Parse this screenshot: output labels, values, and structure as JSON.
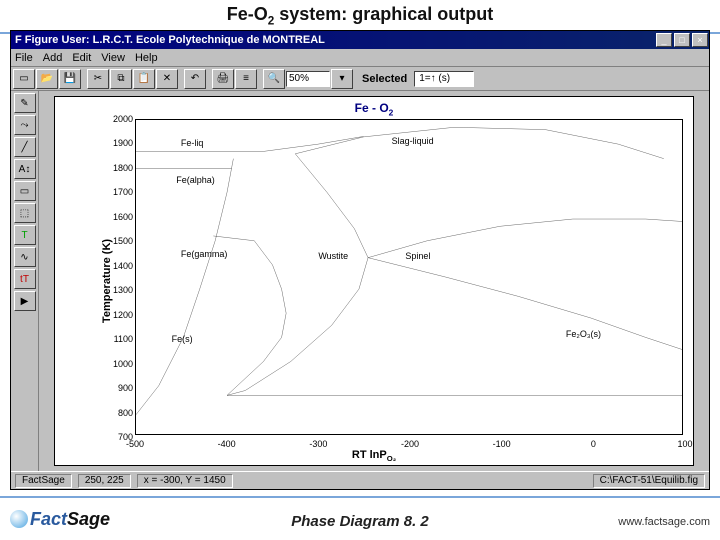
{
  "slide": {
    "title_prefix": "Fe-O",
    "title_sub": "2",
    "title_suffix": " system: graphical output",
    "footer_center": "Phase Diagram  8. 2",
    "footer_url": "www.factsage.com",
    "logo_left": "Fact",
    "logo_right": "Sage"
  },
  "window": {
    "title": "F Figure    User: L.R.C.T.   Ecole Polytechnique de MONTREAL",
    "min_label": "_",
    "max_label": "□",
    "close_label": "×"
  },
  "menus": [
    "File",
    "Add",
    "Edit",
    "View",
    "Help"
  ],
  "toolbar_zoom": "50%",
  "toolbar_selected_label": "Selected",
  "toolbar_selected_value": "1=↑ (s)",
  "status": {
    "app": "FactSage",
    "xy": "250, 225",
    "coords": "x = -300, Y = 1450",
    "path": "C:\\FACT-51\\Equilib.fig"
  },
  "chart_data": {
    "type": "phase-diagram",
    "title_prefix": "Fe - O",
    "title_sub": "2",
    "xlabel_prefix": "RT lnP",
    "xlabel_sub": "O₂",
    "ylabel": "Temperature (K)",
    "xlim": [
      -500,
      100
    ],
    "ylim": [
      700,
      2000
    ],
    "xticks": [
      -500,
      -400,
      -300,
      -200,
      -100,
      0,
      100
    ],
    "yticks": [
      700,
      800,
      900,
      1000,
      1100,
      1200,
      1300,
      1400,
      1500,
      1600,
      1700,
      1800,
      1900,
      2000
    ],
    "phase_labels": [
      {
        "text": "Fe-liq",
        "x": -450,
        "y": 1900
      },
      {
        "text": "Fe(alpha)",
        "x": -455,
        "y": 1750
      },
      {
        "text": "Fe(gamma)",
        "x": -450,
        "y": 1450
      },
      {
        "text": "Fe(s)",
        "x": -460,
        "y": 1100
      },
      {
        "text": "Slag-liquid",
        "x": -220,
        "y": 1910
      },
      {
        "text": "Wustite",
        "x": -300,
        "y": 1440
      },
      {
        "text": "Spinel",
        "x": -205,
        "y": 1440
      },
      {
        "text": "Fe₂O₃(s)",
        "x": -30,
        "y": 1120
      }
    ],
    "curves": [
      {
        "name": "fe-left-boundary",
        "pts": [
          [
            -500,
            780
          ],
          [
            -475,
            900
          ],
          [
            -448,
            1100
          ],
          [
            -430,
            1300
          ],
          [
            -413,
            1500
          ],
          [
            -400,
            1700
          ],
          [
            -393,
            1840
          ]
        ]
      },
      {
        "name": "fe-alpha-top",
        "pts": [
          [
            -500,
            1800
          ],
          [
            -395,
            1800
          ]
        ]
      },
      {
        "name": "fe-liq-top",
        "pts": [
          [
            -500,
            1870
          ],
          [
            -360,
            1870
          ],
          [
            -300,
            1900
          ],
          [
            -250,
            1932
          ]
        ]
      },
      {
        "name": "wustite-left",
        "pts": [
          [
            -415,
            1520
          ],
          [
            -370,
            1500
          ],
          [
            -350,
            1400
          ],
          [
            -340,
            1300
          ],
          [
            -335,
            1200
          ],
          [
            -340,
            1100
          ],
          [
            -360,
            1000
          ],
          [
            -400,
            860
          ]
        ]
      },
      {
        "name": "wustite-right",
        "pts": [
          [
            -325,
            1860
          ],
          [
            -290,
            1700
          ],
          [
            -260,
            1550
          ],
          [
            -245,
            1430
          ],
          [
            -255,
            1300
          ],
          [
            -285,
            1150
          ],
          [
            -330,
            1000
          ],
          [
            -380,
            880
          ],
          [
            -400,
            860
          ]
        ]
      },
      {
        "name": "spinel-top",
        "pts": [
          [
            -325,
            1860
          ],
          [
            -250,
            1930
          ],
          [
            -150,
            1970
          ],
          [
            -50,
            1960
          ],
          [
            30,
            1900
          ],
          [
            80,
            1840
          ]
        ]
      },
      {
        "name": "spinel-right",
        "pts": [
          [
            -245,
            1430
          ],
          [
            -180,
            1500
          ],
          [
            -100,
            1560
          ],
          [
            -20,
            1590
          ],
          [
            60,
            1590
          ],
          [
            100,
            1580
          ]
        ]
      },
      {
        "name": "hematite-boundary",
        "pts": [
          [
            -245,
            1430
          ],
          [
            -160,
            1350
          ],
          [
            -80,
            1270
          ],
          [
            0,
            1180
          ],
          [
            60,
            1100
          ],
          [
            100,
            1050
          ]
        ]
      },
      {
        "name": "bottom-isotherm",
        "pts": [
          [
            -400,
            860
          ],
          [
            -300,
            860
          ],
          [
            -200,
            860
          ],
          [
            -100,
            860
          ],
          [
            0,
            860
          ],
          [
            100,
            860
          ]
        ]
      }
    ]
  }
}
